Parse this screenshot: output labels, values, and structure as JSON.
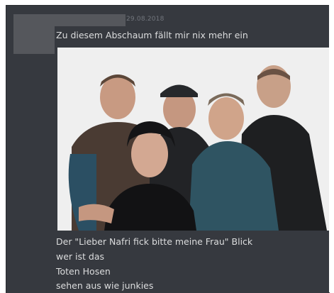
{
  "message": {
    "timestamp": "29.08.2018",
    "lines": [
      "Zu diesem Abschaum fällt mir nix mehr ein",
      "Der \"Lieber Nafri fick bitte meine Frau\" Blick",
      "wer ist das",
      "Toten Hosen",
      "sehen aus wie junkies"
    ]
  },
  "colors": {
    "background": "#36393f",
    "text": "#dcddde",
    "timestamp": "#72767d",
    "redaction": "#55575c"
  }
}
